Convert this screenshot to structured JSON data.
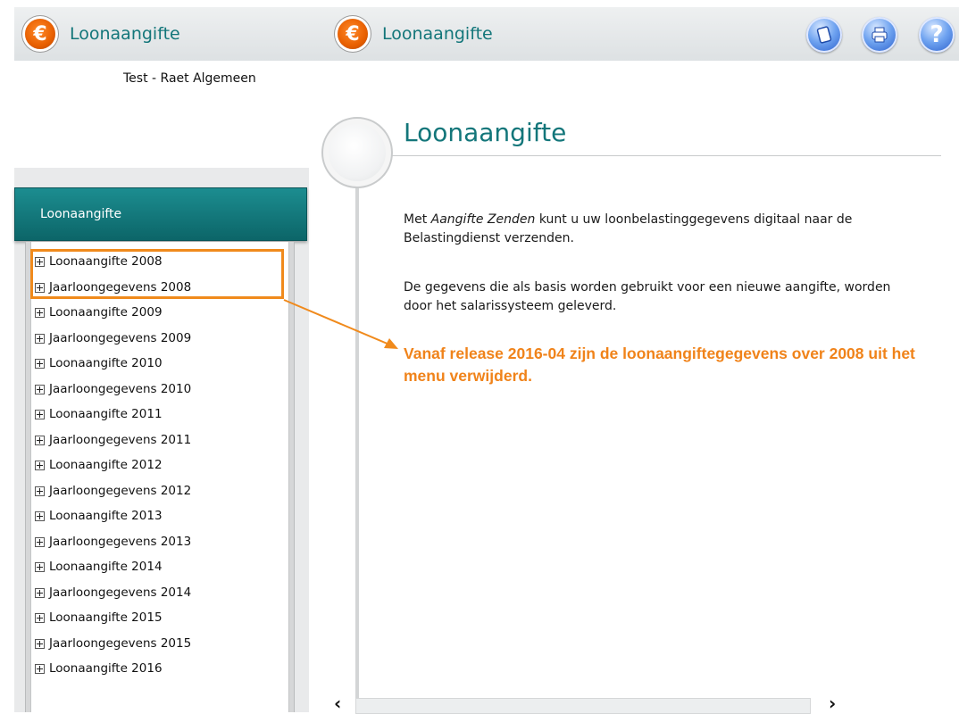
{
  "header": {
    "app_title_left": "Loonaangifte",
    "app_title_right": "Loonaangifte",
    "tools": [
      "document-icon",
      "print-icon",
      "help-icon"
    ],
    "help_glyph": "?"
  },
  "account": {
    "name": "Test - Raet Algemeen"
  },
  "sidebar": {
    "title": "Loonaangifte",
    "items": [
      {
        "label": "Loonaangifte 2008"
      },
      {
        "label": "Jaarloongegevens 2008"
      },
      {
        "label": "Loonaangifte 2009"
      },
      {
        "label": "Jaarloongegevens 2009"
      },
      {
        "label": "Loonaangifte 2010"
      },
      {
        "label": "Jaarloongegevens 2010"
      },
      {
        "label": "Loonaangifte 2011"
      },
      {
        "label": "Jaarloongegevens 2011"
      },
      {
        "label": "Loonaangifte 2012"
      },
      {
        "label": "Jaarloongegevens 2012"
      },
      {
        "label": "Loonaangifte 2013"
      },
      {
        "label": "Jaarloongegevens 2013"
      },
      {
        "label": "Loonaangifte 2014"
      },
      {
        "label": "Jaarloongegevens 2014"
      },
      {
        "label": "Loonaangifte 2015"
      },
      {
        "label": "Jaarloongegevens 2015"
      },
      {
        "label": "Loonaangifte 2016"
      }
    ]
  },
  "main": {
    "title": "Loonaangifte",
    "intro_prefix": "Met ",
    "intro_emphasis": "Aangifte Zenden",
    "intro_rest": " kunt u uw loonbelastinggegevens digitaal naar de Belastingdienst verzenden.",
    "paragraph2": "De gegevens die als basis worden gebruikt voor een nieuwe aangifte, worden door het salarissysteem geleverd.",
    "note": "Vanaf release 2016-04 zijn de loonaangiftegegevens over 2008 uit het menu verwijderd."
  },
  "scroll": {
    "left": "‹",
    "right": "›"
  },
  "colors": {
    "accent_teal": "#13767a",
    "annotation_orange": "#f0831a",
    "header_teal": "#0c6568"
  }
}
